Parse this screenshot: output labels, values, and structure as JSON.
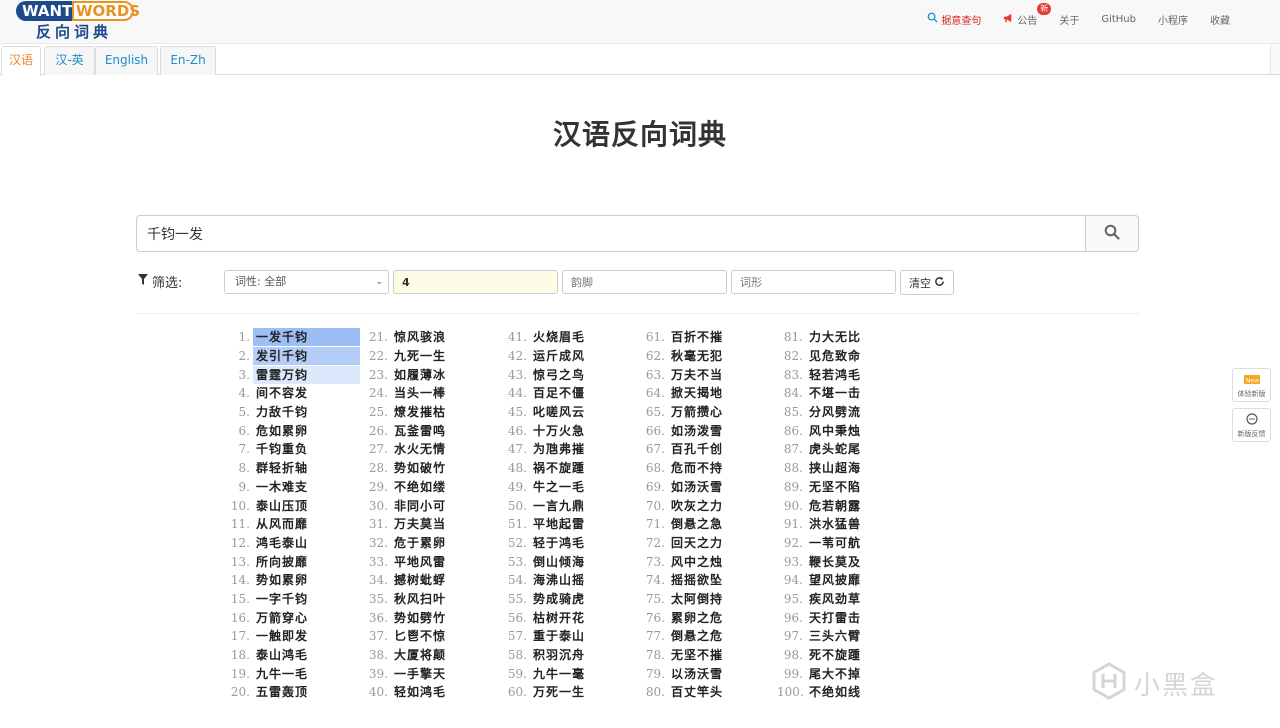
{
  "logo": {
    "part1": "WANT",
    "part2": "WORDS",
    "subtitle": "反向词典"
  },
  "nav": {
    "sentence_search": "据意查句",
    "notice": "公告",
    "notice_badge": "新",
    "about": "关于",
    "github": "GitHub",
    "mini_program": "小程序",
    "favorites": "收藏"
  },
  "tabs": [
    "汉语",
    "汉-英",
    "English",
    "En-Zh"
  ],
  "title": "汉语反向词典",
  "search": {
    "value": "千钧一发"
  },
  "filters": {
    "label": "筛选:",
    "pos": "词性: 全部",
    "length": "4",
    "rhyme_placeholder": "韵脚",
    "shape_placeholder": "词形",
    "clear": "清空"
  },
  "side": {
    "new_version": "体验新版",
    "feedback": "新版反馈"
  },
  "watermark": "小黑盒",
  "highlight_colors": [
    "#9dbdf5",
    "#b4cdf7",
    "#dce8fb"
  ],
  "results": [
    [
      "一发千钧",
      "发引千钧",
      "雷霆万钧",
      "间不容发",
      "力敌千钧",
      "危如累卵",
      "千钧重负",
      "群轻折轴",
      "一木难支",
      "泰山压顶",
      "从风而靡",
      "鸿毛泰山",
      "所向披靡",
      "势如累卵",
      "一字千钧",
      "万箭穿心",
      "一触即发",
      "泰山鸿毛",
      "九牛一毛",
      "五雷轰顶"
    ],
    [
      "惊风骇浪",
      "九死一生",
      "如履薄冰",
      "当头一棒",
      "燎发摧枯",
      "瓦釜雷鸣",
      "水火无情",
      "势如破竹",
      "不绝如缕",
      "非同小可",
      "万夫莫当",
      "危于累卵",
      "平地风雷",
      "撼树蚍蜉",
      "秋风扫叶",
      "势如劈竹",
      "匕鬯不惊",
      "大厦将颠",
      "一手擎天",
      "轻如鸿毛"
    ],
    [
      "火烧眉毛",
      "运斤成风",
      "惊弓之鸟",
      "百足不僵",
      "叱嗟风云",
      "十万火急",
      "为虺弗摧",
      "祸不旋踵",
      "牛之一毛",
      "一言九鼎",
      "平地起雷",
      "轻于鸿毛",
      "倒山倾海",
      "海沸山摇",
      "势成骑虎",
      "枯树开花",
      "重于泰山",
      "积羽沉舟",
      "九牛一毫",
      "万死一生"
    ],
    [
      "百折不摧",
      "秋毫无犯",
      "万夫不当",
      "掀天揭地",
      "万箭攒心",
      "如汤泼雪",
      "百孔千创",
      "危而不持",
      "如汤沃雪",
      "吹灰之力",
      "倒悬之急",
      "回天之力",
      "风中之烛",
      "摇摇欲坠",
      "太阿倒持",
      "累卵之危",
      "倒悬之危",
      "无坚不摧",
      "以汤沃雪",
      "百丈竿头"
    ],
    [
      "力大无比",
      "见危致命",
      "轻若鸿毛",
      "不堪一击",
      "分风劈流",
      "风中秉烛",
      "虎头蛇尾",
      "挟山超海",
      "无坚不陷",
      "危若朝露",
      "洪水猛兽",
      "一苇可航",
      "鞭长莫及",
      "望风披靡",
      "疾风劲草",
      "天打雷击",
      "三头六臂",
      "死不旋踵",
      "尾大不掉",
      "不绝如线"
    ]
  ]
}
